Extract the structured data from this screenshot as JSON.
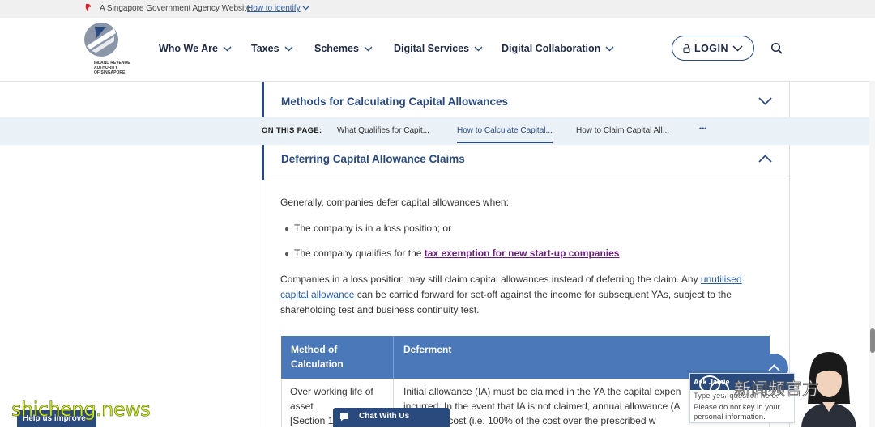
{
  "masthead": {
    "gov_text": "A Singapore Government Agency Website",
    "identify_link": "How to identify"
  },
  "logo": {
    "line1": "INLAND REVENUE",
    "line2": "AUTHORITY",
    "line3": "OF SINGAPORE"
  },
  "nav": {
    "items": [
      {
        "label": "Who We Are"
      },
      {
        "label": "Taxes"
      },
      {
        "label": "Schemes"
      },
      {
        "label": "Digital Services"
      },
      {
        "label": "Digital Collaboration"
      }
    ],
    "login": "LOGIN"
  },
  "accordion_methods": {
    "title": "Methods for Calculating Capital Allowances"
  },
  "on_this_page": {
    "label": "ON THIS PAGE:",
    "links": [
      "What Qualifies for Capit...",
      "How to Calculate Capital...",
      "How to Claim Capital All..."
    ],
    "more": "•••"
  },
  "accordion_deferring": {
    "title": "Deferring Capital Allowance Claims",
    "intro": "Generally, companies defer capital allowances when:",
    "bullets": {
      "b1": "The company is in a loss position; or",
      "b2_prefix": "The company qualifies for the ",
      "b2_link": "tax exemption for new start-up companies",
      "b2_suffix": "."
    },
    "para": {
      "part1": "Companies in a loss position may still claim capital allowances instead of deferring the claim. Any ",
      "link1": "unutilised",
      "link2": "capital allowance",
      "part2": " can be carried forward for set-off against the income for subsequent YAs, subject to the",
      "part3": "shareholding test and business continuity test."
    }
  },
  "table": {
    "headers": [
      "Method of",
      "Calculation",
      "Deferment"
    ],
    "row1": {
      "col1": [
        "Over working life of",
        "asset",
        "[Section 1"
      ],
      "col2": [
        "Initial allowance (IA) must be claimed in the YA the capital expen",
        "incurred. In the event that IA is not claimed, annual allowance (A",
        "on the full cost (i.e. 100% of the cost over the prescribed w"
      ]
    }
  },
  "chatbot": {
    "header": "Ask Jamie",
    "input": "Type your question here.",
    "note": "Please do not key in your personal information."
  },
  "buttons": {
    "chat_with_us": "Chat With Us",
    "help_improve": "Help us improve"
  },
  "watermarks": {
    "site": "shicheng.news",
    "cn": "新闻频官方"
  },
  "colors": {
    "brand_blue": "#2a4a7e",
    "table_header": "#4a78b8",
    "link": "#2a5b9e",
    "visited_link": "#6b1f7c"
  }
}
